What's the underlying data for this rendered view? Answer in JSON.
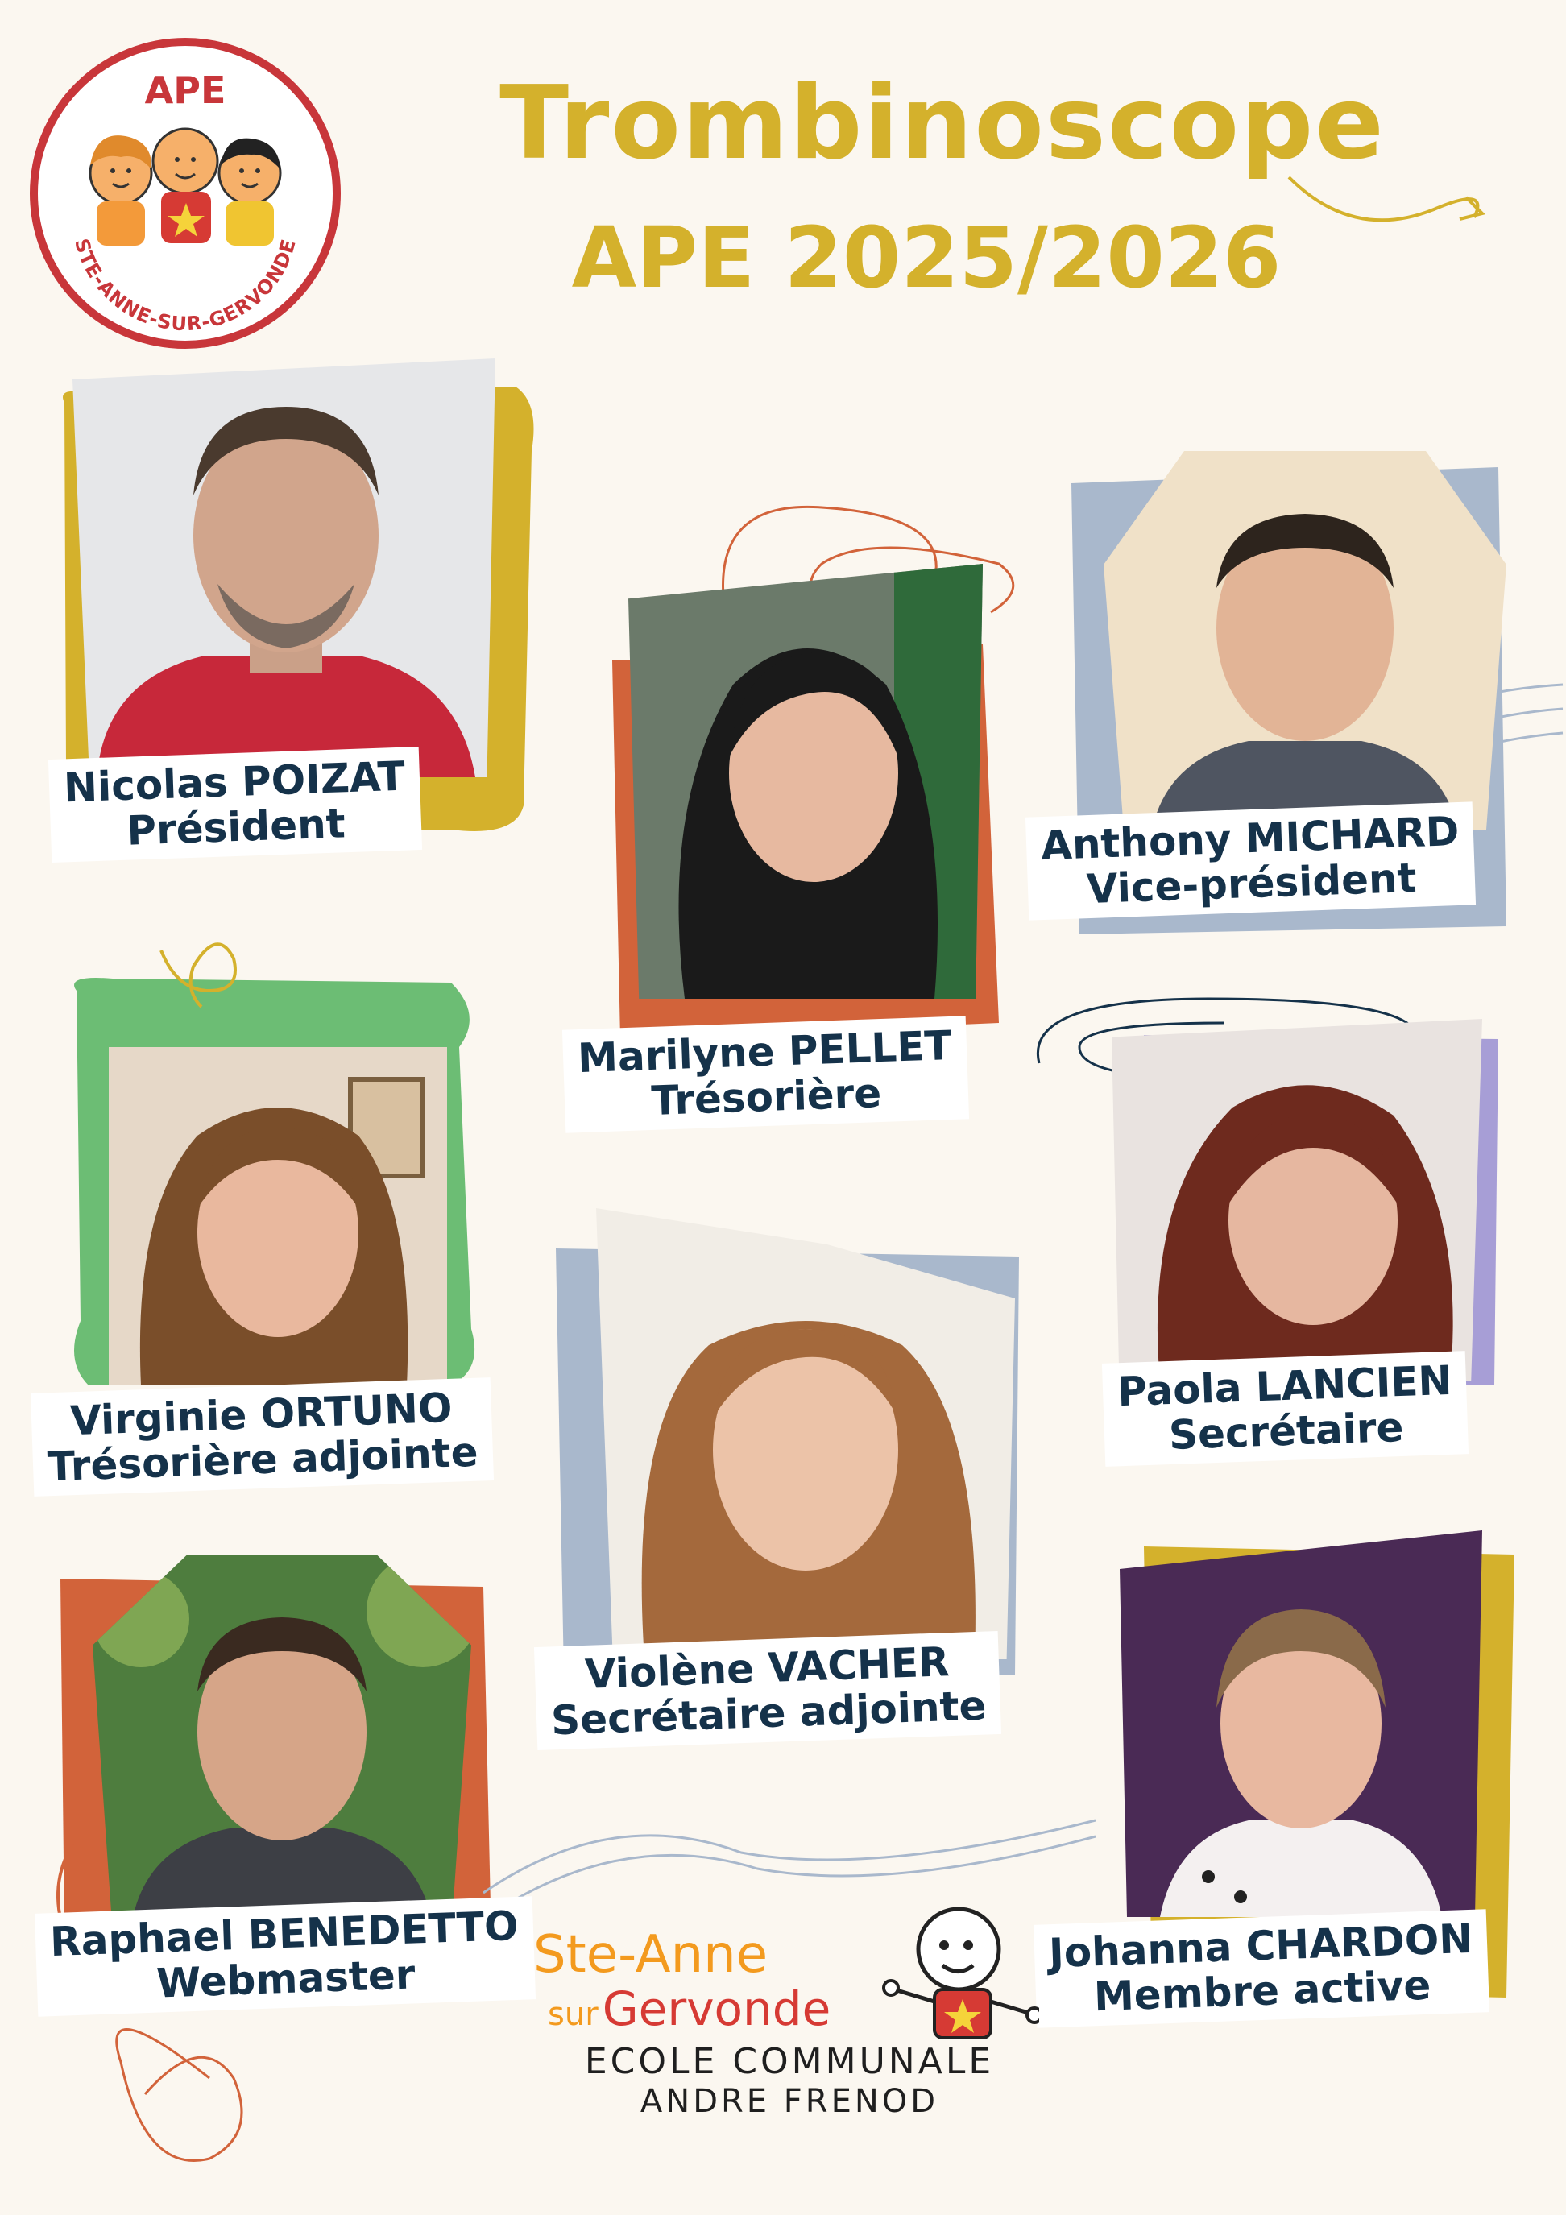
{
  "logo": {
    "top_text": "APE",
    "ring_text": "STE-ANNE-SUR-GERVONDE"
  },
  "header": {
    "title": "Trombinoscope",
    "subtitle": "APE 2025/2026"
  },
  "members": [
    {
      "name": "Nicolas POIZAT",
      "role": "Président"
    },
    {
      "name": "Marilyne PELLET",
      "role": "Trésorière"
    },
    {
      "name": "Anthony MICHARD",
      "role": "Vice-président"
    },
    {
      "name": "Virginie ORTUNO",
      "role": "Trésorière adjointe"
    },
    {
      "name": "Violène VACHER",
      "role": "Secrétaire adjointe"
    },
    {
      "name": "Paola LANCIEN",
      "role": "Secrétaire"
    },
    {
      "name": "Raphael BENEDETTO",
      "role": "Webmaster"
    },
    {
      "name": "Johanna CHARDON",
      "role": "Membre active"
    }
  ],
  "footer": {
    "brand_line1": "Ste-Anne",
    "brand_line2_a": "sur",
    "brand_line2_b": "Gervonde",
    "school_line1": "ECOLE COMMUNALE",
    "school_line2": "ANDRE FRENOD"
  },
  "colors": {
    "mustard": "#d4b12c",
    "orange": "#d2633a",
    "green": "#6cbd74",
    "blue_grey": "#a9b8cc",
    "lavender": "#a79ed6",
    "navy": "#15324a",
    "logo_red": "#c8363a"
  }
}
